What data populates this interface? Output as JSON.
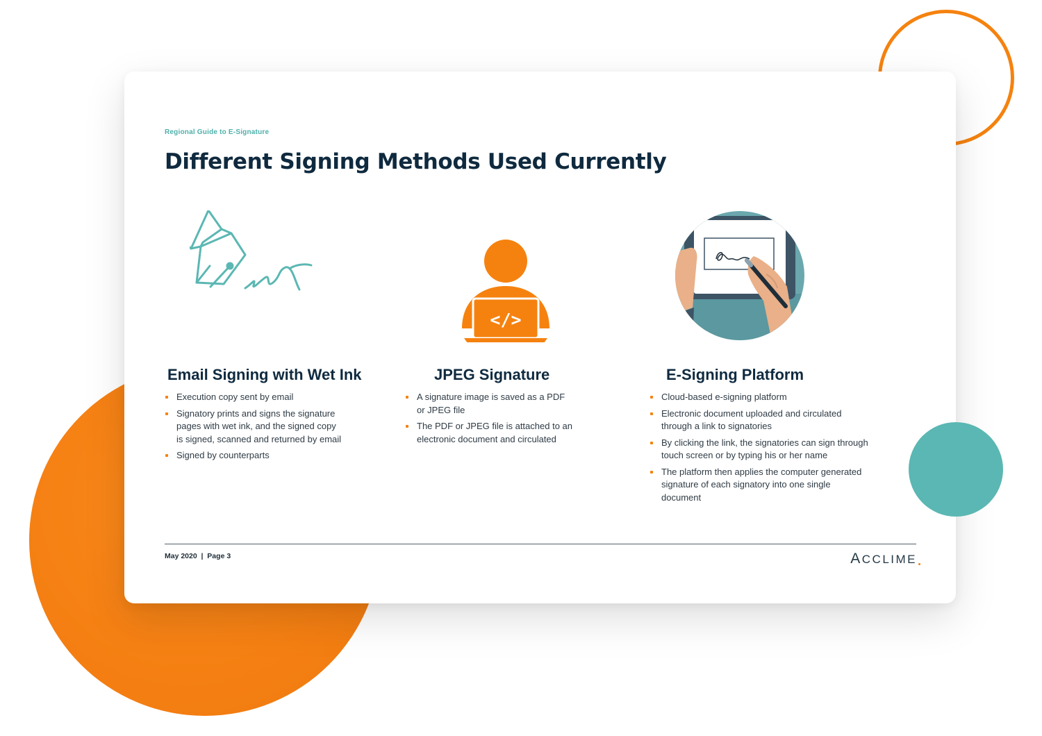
{
  "document": {
    "eyebrow": "Regional Guide to E-Signature",
    "title": "Different Signing Methods Used Currently",
    "methods": [
      {
        "title": "Email Signing with Wet Ink",
        "illustration": "fountain-pen-icon",
        "bullets": [
          "Execution copy sent by email",
          "Signatory prints and signs the signature pages with wet ink, and the signed copy is signed, scanned and returned by email",
          "Signed by counterparts"
        ]
      },
      {
        "title": "JPEG Signature",
        "illustration": "person-laptop-code-icon",
        "bullets": [
          "A signature image is saved as a PDF or JPEG file",
          "The PDF or JPEG file is attached to an electronic document and circulated"
        ]
      },
      {
        "title": "E-Signing Platform",
        "illustration": "tablet-signing-icon",
        "bullets": [
          "Cloud-based e-signing platform",
          "Electronic document uploaded and circulated through a link to signatories",
          "By clicking the link, the signatories can sign through touch screen or by typing his or her name",
          "The platform then applies the computer generated signature of each signatory into one single document"
        ]
      }
    ],
    "footer": {
      "date_page": "May 2020  |  Page 3",
      "logo_text_first": "A",
      "logo_text_rest": "CCLIME"
    }
  },
  "colors": {
    "accent_orange": "#f5820f",
    "accent_teal": "#4fb0ab",
    "title_navy": "#0f2a3f"
  }
}
